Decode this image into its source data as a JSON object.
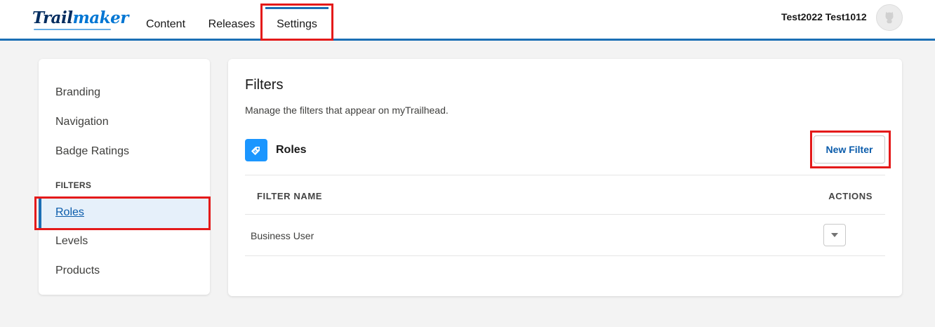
{
  "app": {
    "logo_part1": "Trail",
    "logo_part2": "maker"
  },
  "nav": {
    "tabs": [
      {
        "label": "Content"
      },
      {
        "label": "Releases"
      },
      {
        "label": "Settings",
        "active": true
      }
    ]
  },
  "user": {
    "name": "Test2022 Test1012"
  },
  "sidebar": {
    "items": [
      {
        "label": "Branding"
      },
      {
        "label": "Navigation"
      },
      {
        "label": "Badge Ratings"
      }
    ],
    "section_heading": "FILTERS",
    "filter_items": [
      {
        "label": "Roles",
        "active": true
      },
      {
        "label": "Levels"
      },
      {
        "label": "Products"
      }
    ]
  },
  "main": {
    "title": "Filters",
    "description": "Manage the filters that appear on myTrailhead.",
    "section_label": "Roles",
    "section_icon": "tag-icon",
    "new_filter_label": "New Filter",
    "table": {
      "columns": [
        "FILTER NAME",
        "ACTIONS"
      ],
      "rows": [
        {
          "name": "Business User"
        }
      ]
    }
  },
  "colors": {
    "accent": "#1b6fb5",
    "link": "#0b5cab",
    "icon_bg": "#1b96ff",
    "highlight": "#e41a1a"
  }
}
